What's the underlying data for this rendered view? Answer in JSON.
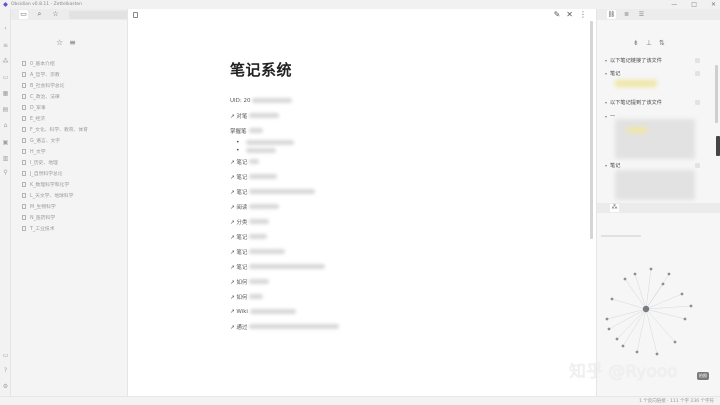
{
  "window": {
    "title": "Obsidian v0.8.11 - Zettelkasten",
    "controls": [
      "—",
      "□",
      "✕"
    ]
  },
  "ribbon": {
    "icons": [
      "collapse-icon",
      "open-quick-switcher-icon",
      "graph-view-icon",
      "new-folder-icon",
      "daily-note-icon",
      "template-icon",
      "tag-icon",
      "workspace-icon",
      "calendar-icon",
      "map-pin-icon",
      "vault-icon",
      "help-icon",
      "settings-icon"
    ]
  },
  "explorer": {
    "tabs": [
      "file-explorer-icon",
      "search-icon",
      "starred-icon"
    ],
    "files": [
      "0_基本介绍",
      "A_哲学、宗教",
      "B_社会科学总论",
      "C_政治、法律",
      "D_军事",
      "E_经济",
      "F_文化、科学、教育、体育",
      "G_语言、文字",
      "H_文学",
      "I_历史、地理",
      "J_自然科学总论",
      "K_数理科学和化学",
      "L_天文学、地球科学",
      "M_生物科学",
      "N_医药科学",
      "T_工业技术"
    ]
  },
  "editor": {
    "title": "笔记系统",
    "uid_label": "UID: 20",
    "lines": [
      {
        "text": "↗ 对笔",
        "blur": 60
      },
      {
        "text": "掌握笔",
        "blur": 0
      }
    ],
    "bullets": [
      "",
      ""
    ],
    "links": [
      "↗ 笔记",
      "↗ 笔记",
      "↗ 笔记",
      "↗ 阅读",
      "↗ 分类",
      "↗ 笔记",
      "↗ 笔记",
      "↗ 笔记",
      "↗ 如何",
      "↗ 如何",
      "↗ Wiki",
      "↗ 通过"
    ],
    "toolbar": [
      "edit-icon",
      "close-icon",
      "more-icon"
    ]
  },
  "right_sidebar": {
    "tabs": [
      "backlinks-icon",
      "outline-icon",
      "tags-icon"
    ],
    "tools": [
      "collapse-results-icon",
      "show-more-context-icon",
      "sort-icon"
    ],
    "linked_title": "以下笔记链接了该文件",
    "linked_item": "笔记",
    "unlinked_title": "以下笔记提到了该文件",
    "unlinked_item_1": "—",
    "unlinked_item_2": "笔记"
  },
  "watermark": {
    "text": "知乎 @Ryooo",
    "tag": "拍照"
  },
  "statusbar": {
    "left": "",
    "right": "1 个反向链接  ·  111 个字  236 个字符"
  },
  "colors": {
    "accent": "#6c4ad1",
    "sidebar_bg": "#f4f4f4",
    "editor_bg": "#ffffff"
  }
}
